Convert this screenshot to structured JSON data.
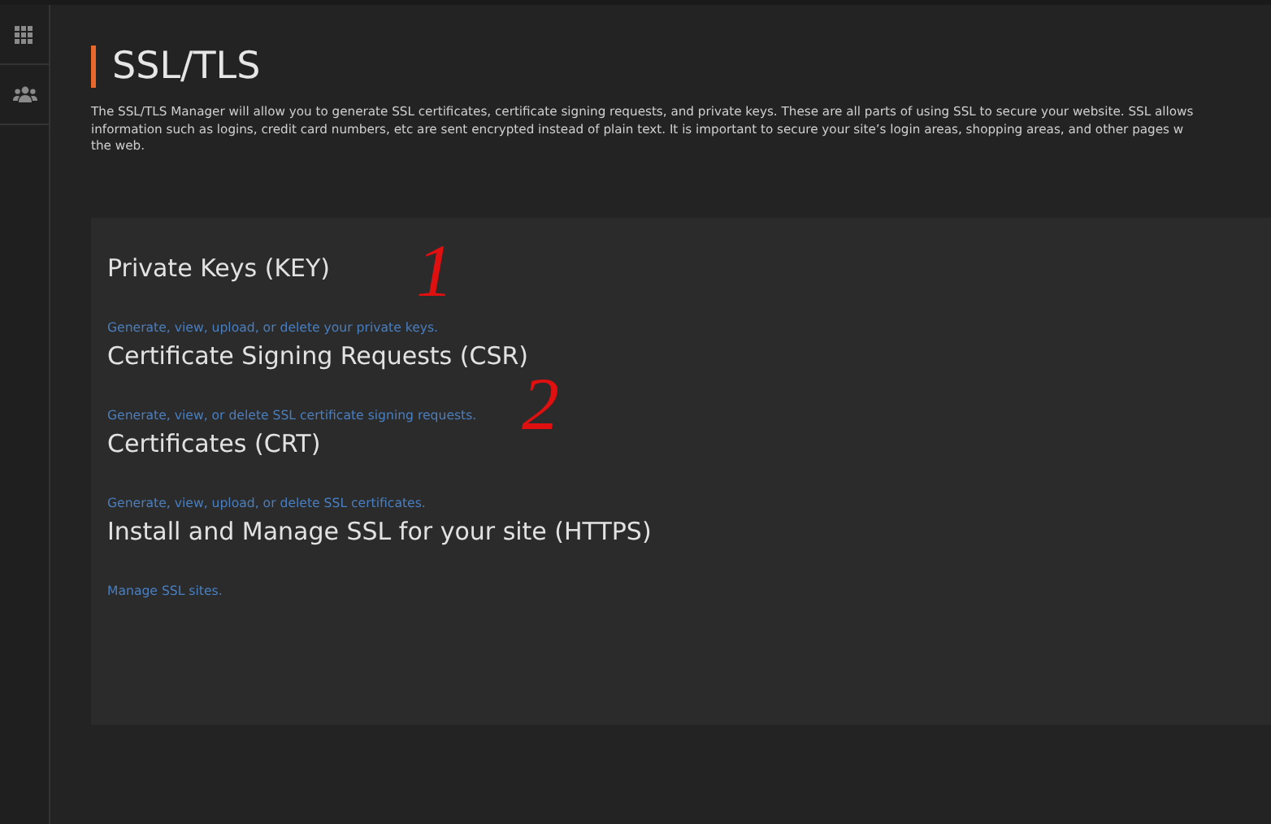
{
  "sidebar": {
    "items": [
      {
        "kind": "grid"
      },
      {
        "kind": "users"
      }
    ]
  },
  "page": {
    "title": "SSL/TLS",
    "description": [
      "The SSL/TLS Manager will allow you to generate SSL certificates, certificate signing requests, and private keys. These are all parts of using SSL to secure your website. SSL allows",
      "information such as logins, credit card numbers, etc are sent encrypted instead of plain text. It is important to secure your site’s login areas, shopping areas, and other pages w",
      "the web."
    ]
  },
  "sections": [
    {
      "heading": "Private Keys (KEY)",
      "link": "Generate, view, upload, or delete your private keys.",
      "annotation": "1"
    },
    {
      "heading": "Certificate Signing Requests (CSR)",
      "link": "Generate, view, or delete SSL certificate signing requests.",
      "annotation": "2"
    },
    {
      "heading": "Certificates (CRT)",
      "link": "Generate, view, upload, or delete SSL certificates."
    },
    {
      "heading": "Install and Manage SSL for your site (HTTPS)",
      "link": "Manage SSL sites."
    }
  ]
}
